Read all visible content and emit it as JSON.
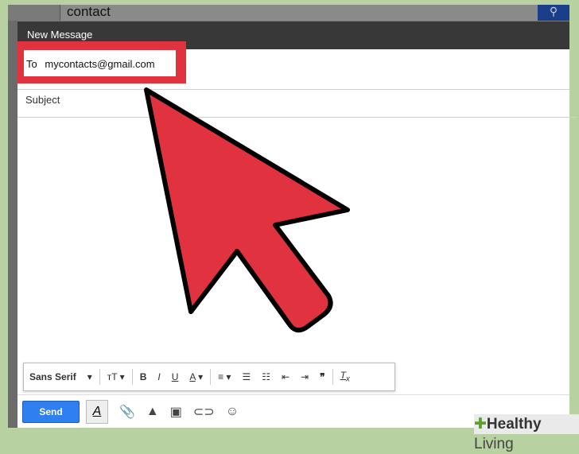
{
  "search": {
    "query": "contact"
  },
  "compose": {
    "title": "New Message",
    "to_label": "To",
    "to_value": "mycontacts@gmail.com",
    "subject_placeholder": "Subject"
  },
  "toolbar": {
    "font": "Sans Serif",
    "items": [
      "size",
      "bold",
      "italic",
      "underline",
      "text-color",
      "align",
      "numbered-list",
      "bulleted-list",
      "indent-less",
      "indent-more",
      "quote",
      "remove-formatting"
    ]
  },
  "bottom": {
    "send_label": "Send"
  },
  "watermark": {
    "brand": "Healthy",
    "brand2": "Living"
  },
  "colors": {
    "highlight": "#e0323f",
    "send": "#2f7ff0"
  }
}
